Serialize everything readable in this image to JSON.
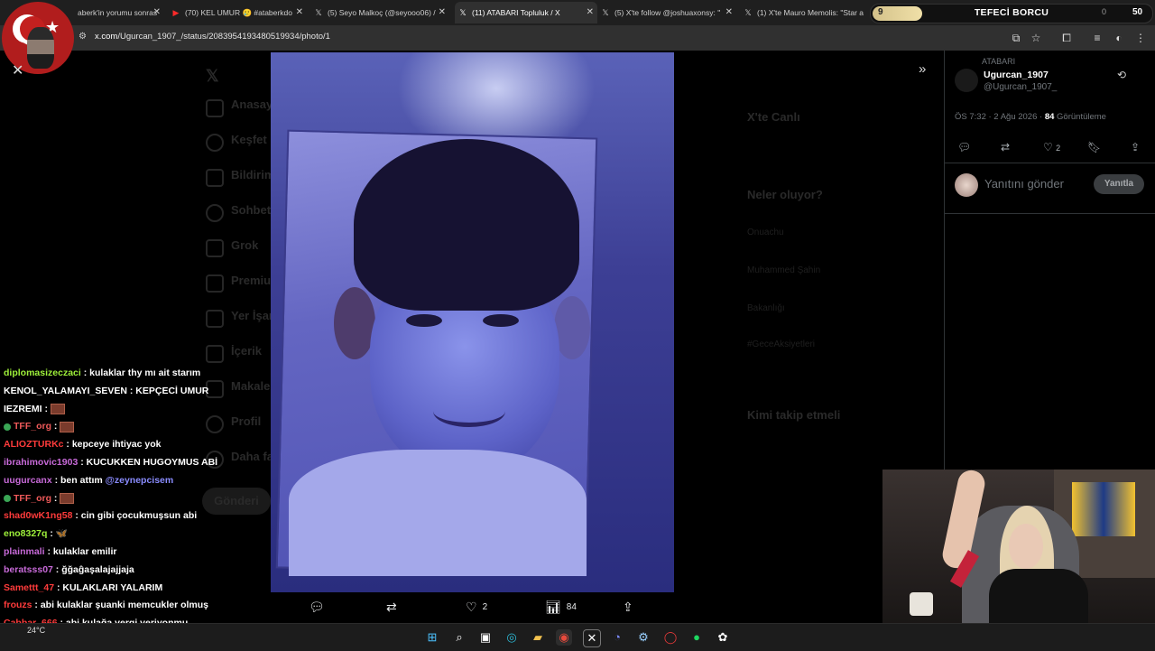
{
  "browser": {
    "tabs": [
      {
        "label": "aberk'in yorumu sonras",
        "icon": "site-icon",
        "active": false
      },
      {
        "label": "(70) KEL UMUR 🥲 #ataberkdo",
        "icon": "youtube-icon",
        "active": false
      },
      {
        "label": "(5) Seyo Malkoç (@seyooo06) /",
        "icon": "x-logo-icon",
        "active": false
      },
      {
        "label": "(11) ATABARI Topluluk / X",
        "icon": "x-logo-icon",
        "active": true
      },
      {
        "label": "(5) X'te follow @joshuaxonsy: \"",
        "icon": "x-logo-icon",
        "active": false
      },
      {
        "label": "(1) X'te Mauro Memolis: \"Star a",
        "icon": "x-logo-icon",
        "active": false
      }
    ],
    "url_host": "x.com",
    "url_path": "/Ugurcan_1907_/status/2083954193480519934/photo/1"
  },
  "overlay_goal": {
    "min": "9",
    "title": "TEFECİ BORCU",
    "current": "0",
    "max": "50",
    "progress_fraction": 0.18
  },
  "x_background": {
    "nav": [
      "Anasayfa",
      "Keşfet",
      "Bildirimler",
      "Sohbet",
      "Grok",
      "Premium",
      "Yer İşaretleri",
      "İçerik",
      "Makaleler",
      "Profil",
      "Daha fazla"
    ],
    "post_button": "Gönderi",
    "trending_title": "X'te Canlı",
    "whats_happening": "Neler oluyor?",
    "trends": [
      "Onuachu",
      "Muhammed Şahin",
      "Bakanlığı",
      "#GeceAksiyetleri"
    ],
    "who_to_follow": "Kimi takip etmeli"
  },
  "media_bar": {
    "reply_count": "",
    "retweet_count": "",
    "like_count": "2",
    "view_count": "84"
  },
  "chat": [
    {
      "user": "diplomasizeczaci",
      "user_color": "#9ef03a",
      "text": ": kulaklar thy mı ait starım",
      "badge": false,
      "emote": false
    },
    {
      "user": "KENOL_YALAMAYI_SEVEN",
      "user_color": "#ffffff",
      "text": ": KEPÇECİ UMUR",
      "badge": false,
      "emote": false
    },
    {
      "user": "IEZREMI",
      "user_color": "#ffffff",
      "text": ":",
      "badge": false,
      "emote": true
    },
    {
      "user": "TFF_org",
      "user_color": "#f05a5a",
      "text": ":",
      "badge": true,
      "emote": true
    },
    {
      "user": "ALIOZTURKc",
      "user_color": "#ff3b3b",
      "text": ": kepceye ihtiyac yok",
      "badge": false,
      "emote": false
    },
    {
      "user": "ibrahimovic1903",
      "user_color": "#c86ad9",
      "text": ": KUCUKKEN HUGOYMUS ABİ",
      "badge": false,
      "emote": false
    },
    {
      "user": "uugurcanx",
      "user_color": "#c86ad9",
      "text": ": ben attım",
      "mention": "@zeynepcisem",
      "badge": false,
      "emote": false
    },
    {
      "user": "TFF_org",
      "user_color": "#f05a5a",
      "text": ":",
      "badge": true,
      "emote": true
    },
    {
      "user": "shad0wK1ng58",
      "user_color": "#ff3b3b",
      "text": ": cin gibi çocukmuşsun abi",
      "badge": false,
      "emote": false
    },
    {
      "user": "eno8327q",
      "user_color": "#9ef03a",
      "text": ": 🦋",
      "badge": false,
      "emote": false
    },
    {
      "user": "plainmali",
      "user_color": "#c86ad9",
      "text": ": kulaklar emilir",
      "badge": false,
      "emote": false
    },
    {
      "user": "beratsss07",
      "user_color": "#c86ad9",
      "text": ": ğğaĝaşalajajjaja",
      "badge": false,
      "emote": false
    },
    {
      "user": "Samettt_47",
      "user_color": "#ff3b3b",
      "text": ": KULAKLARI YALARIM",
      "badge": false,
      "emote": false
    },
    {
      "user": "frouzs",
      "user_color": "#ff3b3b",
      "text": ": abi kulaklar şuanki memcukler olmuş",
      "badge": false,
      "emote": false
    },
    {
      "user": "Cabbar_666",
      "user_color": "#ff3b3b",
      "text": ": abi kulağa vergi veriyonmu",
      "badge": false,
      "emote": false
    }
  ],
  "sidebar": {
    "retweet_label": "ATABARI",
    "name": "Ugurcan_1907",
    "handle": "@Ugurcan_1907_",
    "meta_prefix": "ÖS 7:32 · 2 Ağu 2026 · ",
    "views_count": "84",
    "views_label": " Görüntüleme",
    "like_count": "2",
    "reply_placeholder": "Yanıtını gönder",
    "reply_button": "Yanıtla"
  },
  "taskbar": {
    "weather_temp": "24°C"
  }
}
